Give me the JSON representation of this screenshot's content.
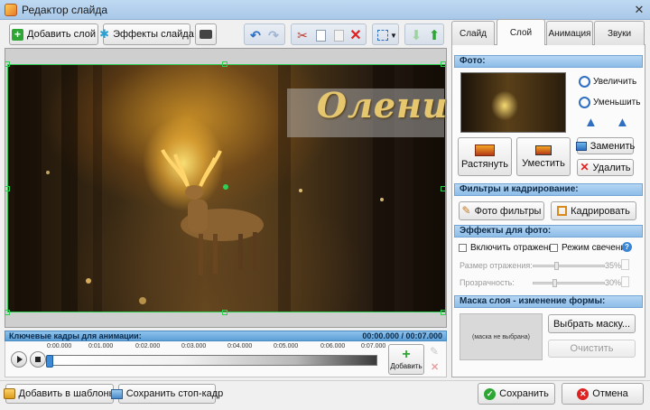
{
  "window": {
    "title": "Редактор слайда",
    "close_glyph": "✕"
  },
  "toolbar": {
    "add_layer": "Добавить слой",
    "slide_effects": "Эффекты слайда"
  },
  "canvas": {
    "caption": "Олени"
  },
  "keyframes": {
    "title": "Ключевые кадры для анимации:",
    "time": "00:00.000 / 00:07.000",
    "ticks": [
      "0:00.000",
      "0:01.000",
      "0:02.000",
      "0:03.000",
      "0:04.000",
      "0:05.000",
      "0:06.000",
      "0:07.000"
    ],
    "add_label": "Добавить"
  },
  "tabs": [
    {
      "label": "Слайд"
    },
    {
      "label": "Слой"
    },
    {
      "label": "Анимация"
    },
    {
      "label": "Звуки"
    }
  ],
  "photo_section": {
    "header": "Фото:",
    "zoom_in": "Увеличить",
    "zoom_out": "Уменьшить",
    "stretch": "Растянуть",
    "fit": "Уместить",
    "replace": "Заменить",
    "delete": "Удалить"
  },
  "filters_section": {
    "header": "Фильтры и кадрирование:",
    "photo_filters": "Фото фильтры",
    "crop": "Кадрировать"
  },
  "effects_section": {
    "header": "Эффекты для фото:",
    "reflection": "Включить отражение",
    "glow": "Режим свечения",
    "reflection_size_label": "Размер отражения:",
    "reflection_size_value": "35%",
    "transparency_label": "Прозрачность:",
    "transparency_value": "30%",
    "help_glyph": "?"
  },
  "mask_section": {
    "header": "Маска слоя - изменение формы:",
    "preview": "(маска не выбрана)",
    "choose": "Выбрать маску...",
    "clear": "Очистить"
  },
  "footer": {
    "add_template": "Добавить в шаблоны",
    "save_frame": "Сохранить стоп-кадр",
    "save": "Сохранить",
    "cancel": "Отмена"
  },
  "colors": {
    "accent_blue": "#5d9fd6",
    "selection_green": "#2fd052",
    "caption_gold": "#e7c76e"
  }
}
